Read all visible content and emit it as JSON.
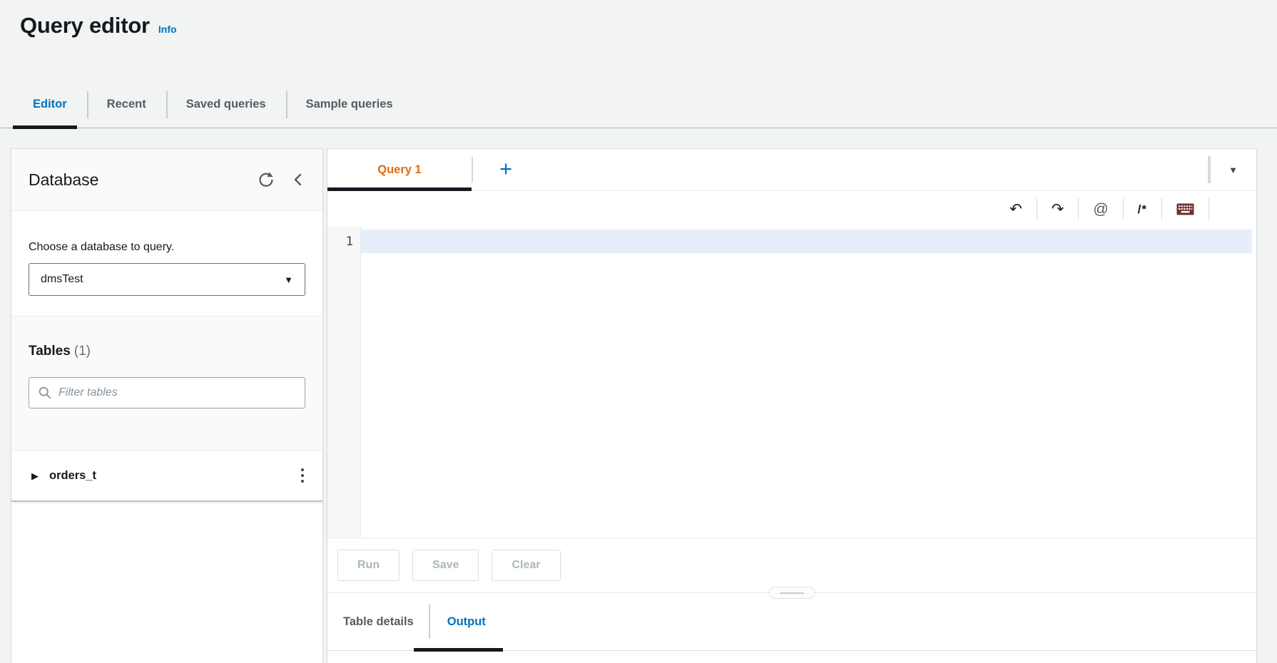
{
  "header": {
    "title": "Query editor",
    "info_link": "Info"
  },
  "nav_tabs": {
    "items": [
      {
        "label": "Editor",
        "active": true
      },
      {
        "label": "Recent",
        "active": false
      },
      {
        "label": "Saved queries",
        "active": false
      },
      {
        "label": "Sample queries",
        "active": false
      }
    ]
  },
  "database_panel": {
    "title": "Database",
    "choose_database_label": "Choose a database to query.",
    "database_select": {
      "value": "dmsTest"
    },
    "tables_heading": "Tables",
    "tables_count": "(1)",
    "filter_input": {
      "placeholder": "Filter tables",
      "value": ""
    },
    "tables": [
      {
        "name": "orders_t"
      }
    ]
  },
  "query_panel": {
    "query_tabs": [
      {
        "label": "Query 1",
        "active": true
      }
    ],
    "add_tab_label": "+",
    "editor": {
      "line_number": "1",
      "content": ""
    },
    "action_buttons": [
      {
        "label": "Run",
        "enabled": false
      },
      {
        "label": "Save",
        "enabled": false
      },
      {
        "label": "Clear",
        "enabled": false
      }
    ],
    "result_tabs": [
      {
        "label": "Table details",
        "active": false
      },
      {
        "label": "Output",
        "active": true
      }
    ]
  },
  "icons": {
    "undo": "↶",
    "redo": "↷",
    "mention": "@",
    "comment": "/*",
    "keyboard": "keyboard-shape",
    "refresh": "circular-arrow",
    "collapse_panel": "chevron-left",
    "search": "magnifier",
    "select_caret": "▼",
    "tab_menu_caret": "▼",
    "expand_row": "▶",
    "kebab": "vertical-dots"
  },
  "colors": {
    "accent_blue": "#0073bb",
    "active_query_tab_orange": "#dd6b10",
    "active_tab_underline": "#16191f",
    "page_background": "#f2f3f3",
    "disabled_text": "#aab7b8",
    "editor_active_line": "#e7eefb",
    "keyboard_icon": "#6d3131"
  }
}
